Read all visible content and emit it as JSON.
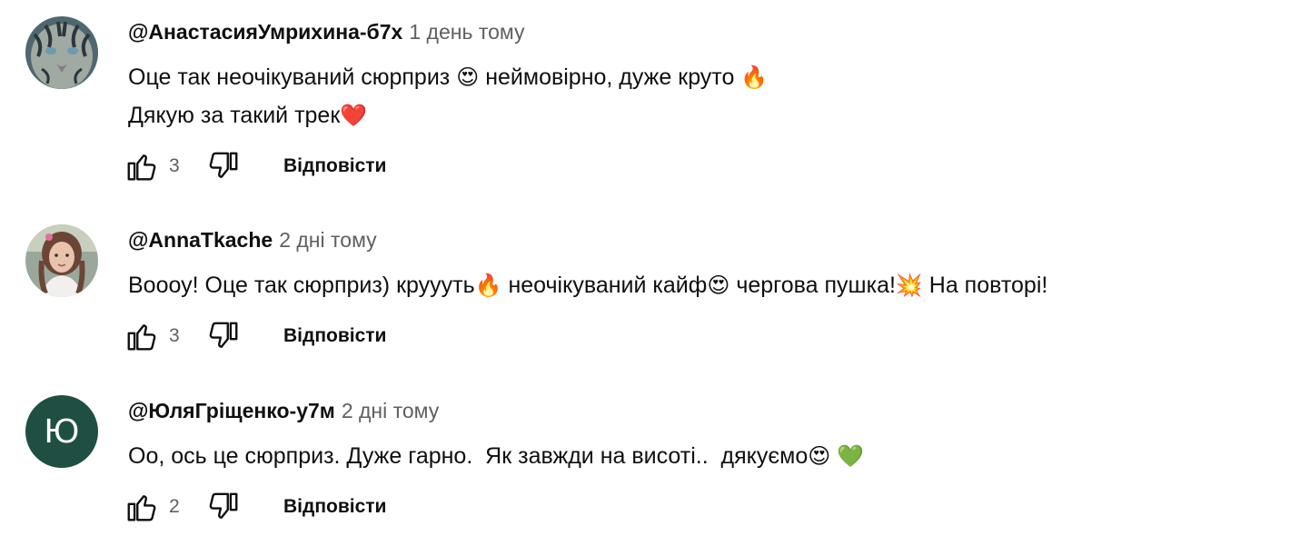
{
  "comments": [
    {
      "author": "@АнастасияУмрихина-б7х",
      "time": "1 день тому",
      "lines": [
        [
          "Оце так неочікуваний сюрприз ",
          "😍",
          " неймовірно, дуже круто ",
          "🔥"
        ],
        [
          "Дякую за такий трек",
          "❤️"
        ]
      ],
      "likes": "3",
      "reply_label": "Відповісти",
      "avatar_icon": "tiger-photo"
    },
    {
      "author": "@AnnaTkache",
      "time": "2 дні тому",
      "lines": [
        [
          "Воооу! Оце так сюрприз) круууть",
          "🔥",
          " неочікуваний кайф",
          "😍",
          " чергова пушка!",
          "💥",
          " На повторі!"
        ]
      ],
      "likes": "3",
      "reply_label": "Відповісти",
      "avatar_icon": "girl-photo"
    },
    {
      "author": "@ЮляГріщенко-у7м",
      "time": "2 дні тому",
      "lines": [
        [
          "Оо, ось це сюрприз. Дуже гарно.  Як завжди на висоті..  дякуємо",
          "😍",
          " ",
          "💚"
        ]
      ],
      "likes": "2",
      "reply_label": "Відповісти",
      "avatar_letter": "Ю",
      "avatar_color": "#1f4f42"
    }
  ]
}
